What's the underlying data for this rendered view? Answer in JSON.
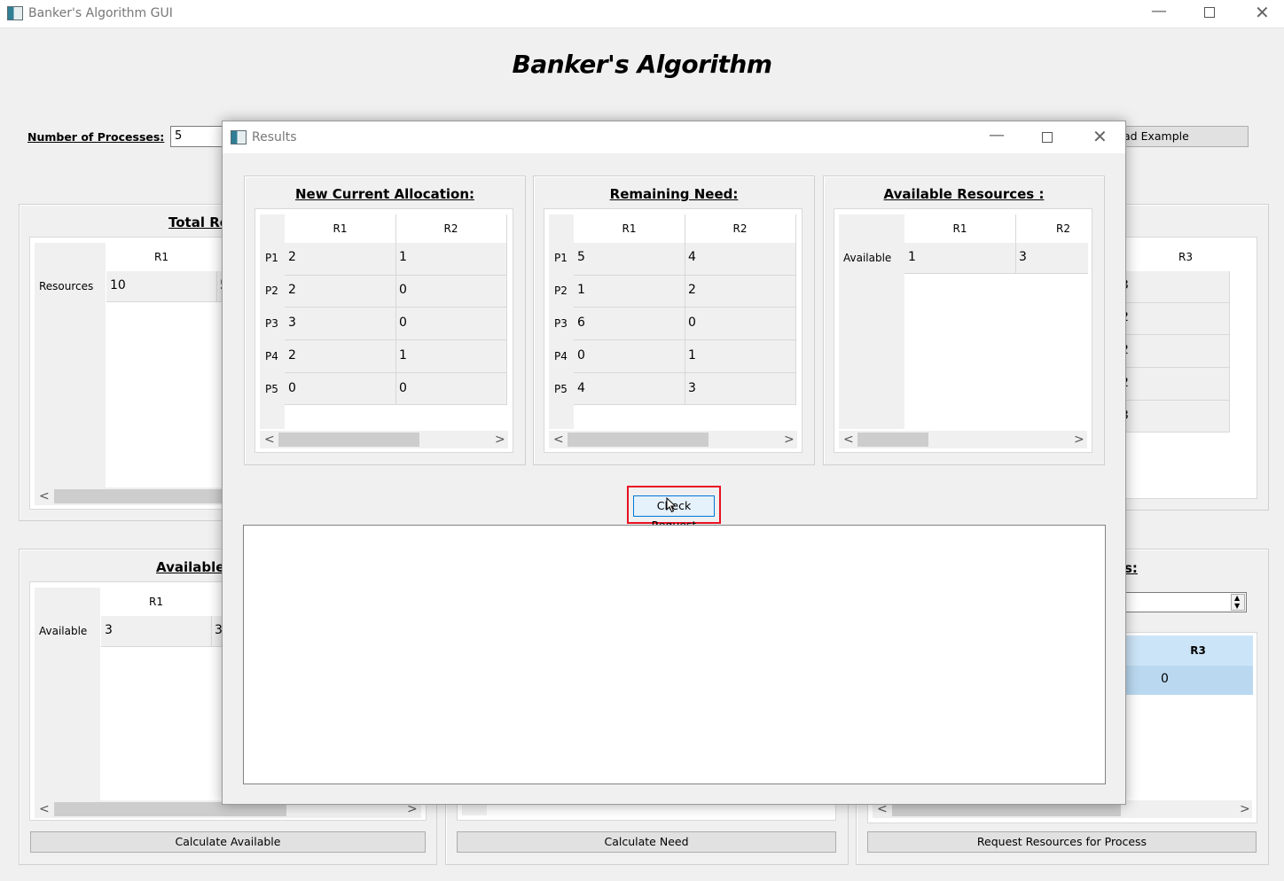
{
  "window": {
    "title": "Banker's Algorithm GUI"
  },
  "main": {
    "heading": "Banker's Algorithm",
    "num_processes_label": "Number of Processes:",
    "num_processes_value": "5",
    "load_example_label": "ad Example",
    "total_group": {
      "title": "Total Re",
      "col_r1": "R1",
      "row_label": "Resources",
      "r1_value": "10",
      "r2_partial": "5"
    },
    "right_group": {
      "col_r3": "R3",
      "values": [
        "3",
        "2",
        "2",
        "2",
        "3"
      ]
    },
    "available_group": {
      "title": "Available",
      "col_r1": "R1",
      "row_label": "Available",
      "r1_value": "3",
      "r2_partial": "3"
    },
    "request_group": {
      "title_partial": "s:",
      "col_r3": "R3",
      "r3_value": "0"
    },
    "buttons": {
      "calculate_available": "Calculate Available",
      "calculate_need": "Calculate Need",
      "request_resources": "Request Resources for Process"
    }
  },
  "dialog": {
    "title": "Results",
    "alloc": {
      "title": "New Current Allocation:",
      "cols": [
        "R1",
        "R2"
      ],
      "rows": [
        {
          "label": "P1",
          "r1": "2",
          "r2": "1"
        },
        {
          "label": "P2",
          "r1": "2",
          "r2": "0"
        },
        {
          "label": "P3",
          "r1": "3",
          "r2": "0"
        },
        {
          "label": "P4",
          "r1": "2",
          "r2": "1"
        },
        {
          "label": "P5",
          "r1": "0",
          "r2": "0"
        }
      ]
    },
    "need": {
      "title": "Remaining Need:",
      "cols": [
        "R1",
        "R2"
      ],
      "rows": [
        {
          "label": "P1",
          "r1": "5",
          "r2": "4"
        },
        {
          "label": "P2",
          "r1": "1",
          "r2": "2"
        },
        {
          "label": "P3",
          "r1": "6",
          "r2": "0"
        },
        {
          "label": "P4",
          "r1": "0",
          "r2": "1"
        },
        {
          "label": "P5",
          "r1": "4",
          "r2": "3"
        }
      ]
    },
    "avail": {
      "title": "Available Resources :",
      "cols": [
        "R1",
        "R2"
      ],
      "row_label": "Available",
      "r1": "1",
      "r2": "3"
    },
    "check_request_label": "Check Request",
    "output_text": ""
  },
  "colors": {
    "highlight": "#e81123",
    "selection": "#cce4f7",
    "button_focus": "#0078d7"
  }
}
